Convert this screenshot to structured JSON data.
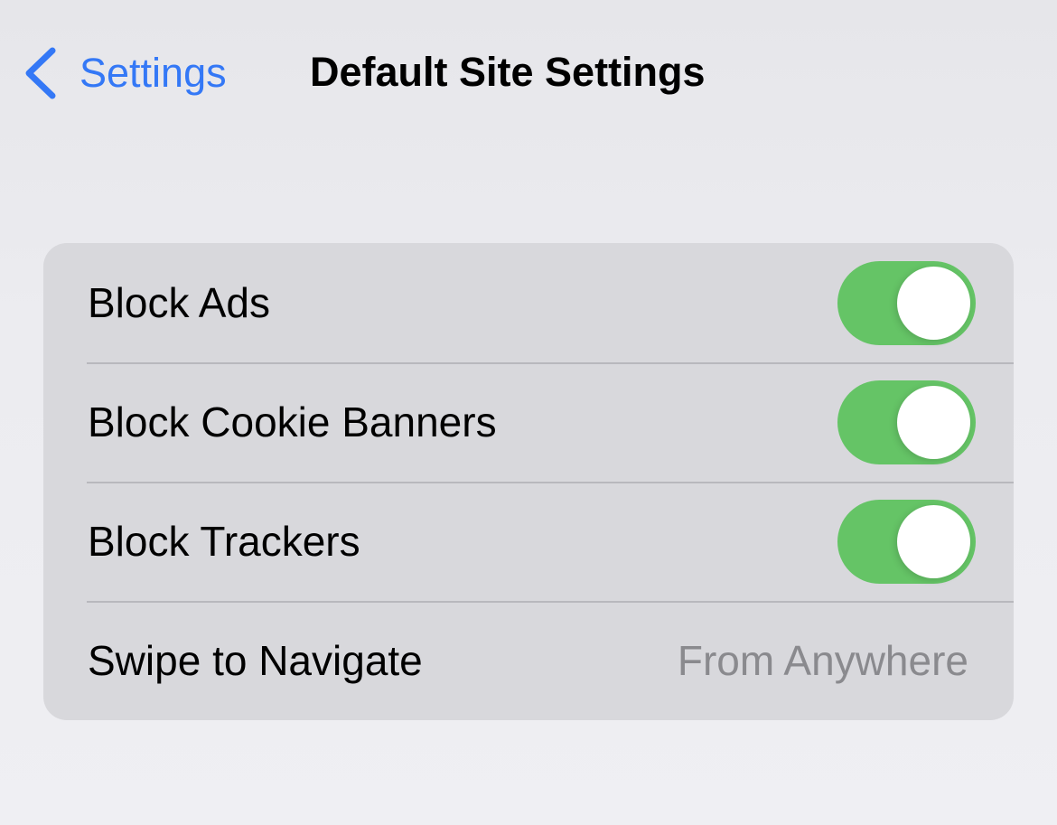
{
  "nav": {
    "back_label": "Settings",
    "title": "Default Site Settings"
  },
  "colors": {
    "accent": "#3478f6",
    "toggle_on": "#65c466"
  },
  "rows": [
    {
      "label": "Block Ads",
      "toggle": true
    },
    {
      "label": "Block Cookie Banners",
      "toggle": true
    },
    {
      "label": "Block Trackers",
      "toggle": true
    },
    {
      "label": "Swipe to Navigate",
      "value": "From Anywhere"
    }
  ]
}
